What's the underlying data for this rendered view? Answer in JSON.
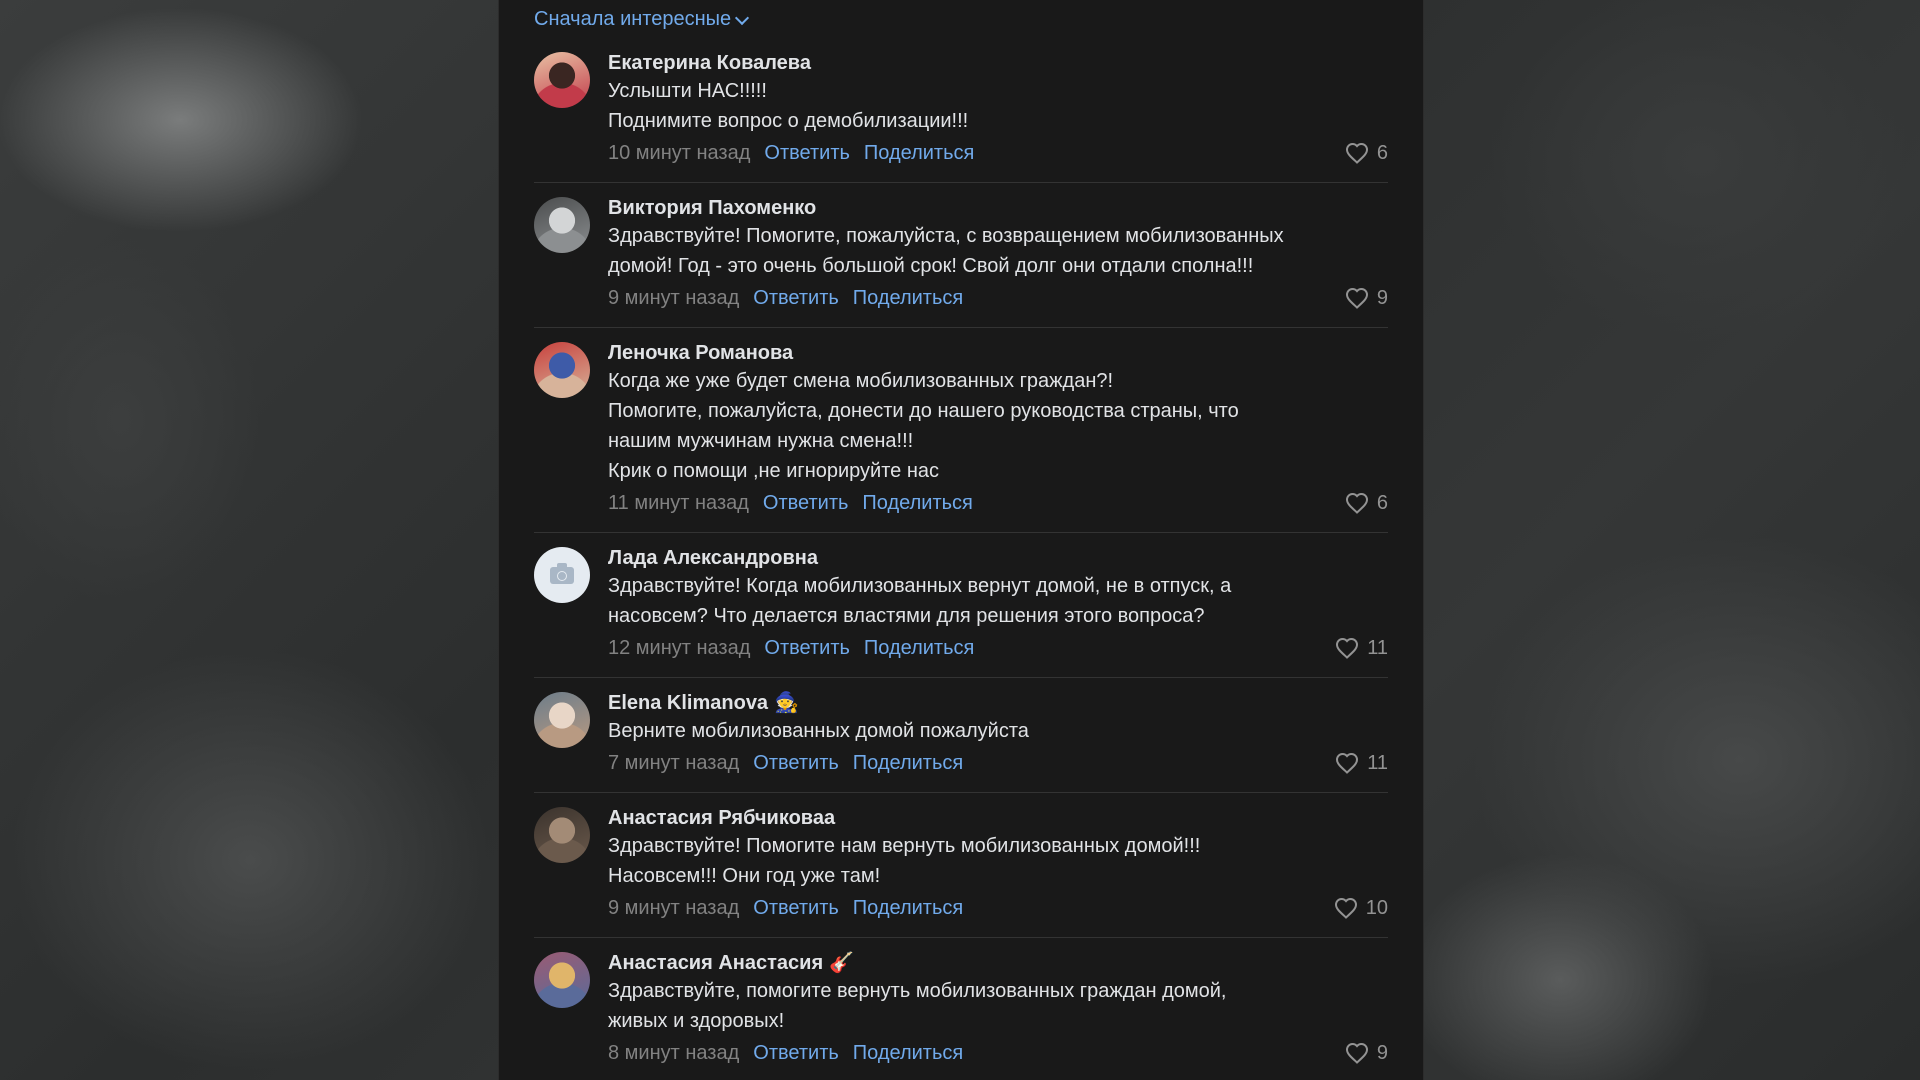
{
  "sort_label": "Сначала интересные",
  "actions": {
    "reply": "Ответить",
    "share": "Поделиться"
  },
  "comments": [
    {
      "author": "Екатерина Ковалева",
      "text": "Услышти НАС!!!!!\nПоднимите вопрос о демобилизации!!!",
      "time": "10 минут назад",
      "likes": "6",
      "avatar": {
        "type": "photo",
        "colors": [
          "#c23b4a",
          "#3a2622",
          "#e8c1a4"
        ]
      }
    },
    {
      "author": "Виктория Пахоменко",
      "text": "Здравствуйте! Помогите, пожалуйста, с возвращением мобилизованных\nдомой! Год - это очень большой срок! Свой долг они отдали сполна!!!",
      "time": "9 минут назад",
      "likes": "9",
      "avatar": {
        "type": "photo",
        "colors": [
          "#8c8f91",
          "#d3d5d6",
          "#4b4d4e"
        ]
      }
    },
    {
      "author": "Леночка Романова",
      "text": "Когда же уже будет смена мобилизованных граждан?!\nПомогите, пожалуйста, донести до нашего руководства страны, что\nнашим мужчинам нужна смена!!!\nКрик о помощи ,не игнорируйте нас",
      "time": "11 минут назад",
      "likes": "6",
      "avatar": {
        "type": "photo",
        "colors": [
          "#d7b39a",
          "#3e5ba8",
          "#c8413d"
        ]
      }
    },
    {
      "author": "Лада Александровна",
      "text": "Здравствуйте! Когда мобилизованных вернут домой, не в отпуск, а\nнасовсем? Что делается властями для решения этого вопроса?",
      "time": "12 минут назад",
      "likes": "11",
      "avatar": {
        "type": "camera"
      }
    },
    {
      "author": "Elena Klimanova",
      "emoji": "🧙",
      "text": "Верните мобилизованных домой пожалуйста",
      "time": "7 минут назад",
      "likes": "11",
      "avatar": {
        "type": "photo",
        "colors": [
          "#b89a82",
          "#e8d6c7",
          "#6d7d8a"
        ]
      }
    },
    {
      "author": "Анастасия Рябчиковаа",
      "text": "Здравствуйте! Помогите нам вернуть мобилизованных домой!!!\nНасовсем!!! Они год уже там!",
      "time": "9 минут назад",
      "likes": "10",
      "avatar": {
        "type": "photo",
        "colors": [
          "#6b5a4c",
          "#a38b76",
          "#3b332d"
        ]
      }
    },
    {
      "author": "Анастасия Анастасия",
      "emoji": "🎸",
      "text": "Здравствуйте, помогите вернуть мобилизованных граждан домой,\nживых и здоровых!",
      "time": "8 минут назад",
      "likes": "9",
      "avatar": {
        "type": "photo",
        "colors": [
          "#5a6b9a",
          "#e0b56a",
          "#9a5b73"
        ]
      }
    }
  ]
}
